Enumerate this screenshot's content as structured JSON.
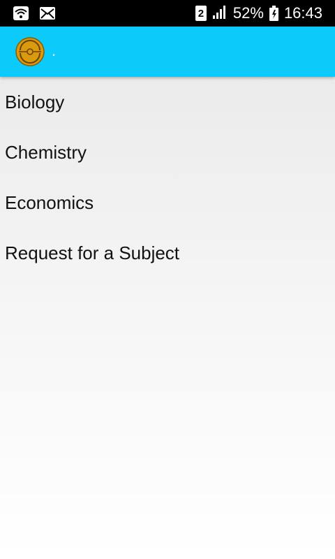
{
  "status_bar": {
    "icons": [
      "wifi-icon",
      "mail-icon",
      "sim-icon",
      "signal-icon",
      "battery-icon"
    ],
    "sim_slot": "2",
    "battery": "52%",
    "time": "16:43"
  },
  "app_bar": {
    "title": ".",
    "color": "#0ccbfb",
    "logo_color": "#d99a0e"
  },
  "subjects": [
    {
      "label": "Biology"
    },
    {
      "label": "Chemistry"
    },
    {
      "label": "Economics"
    },
    {
      "label": "Request for a Subject"
    }
  ]
}
